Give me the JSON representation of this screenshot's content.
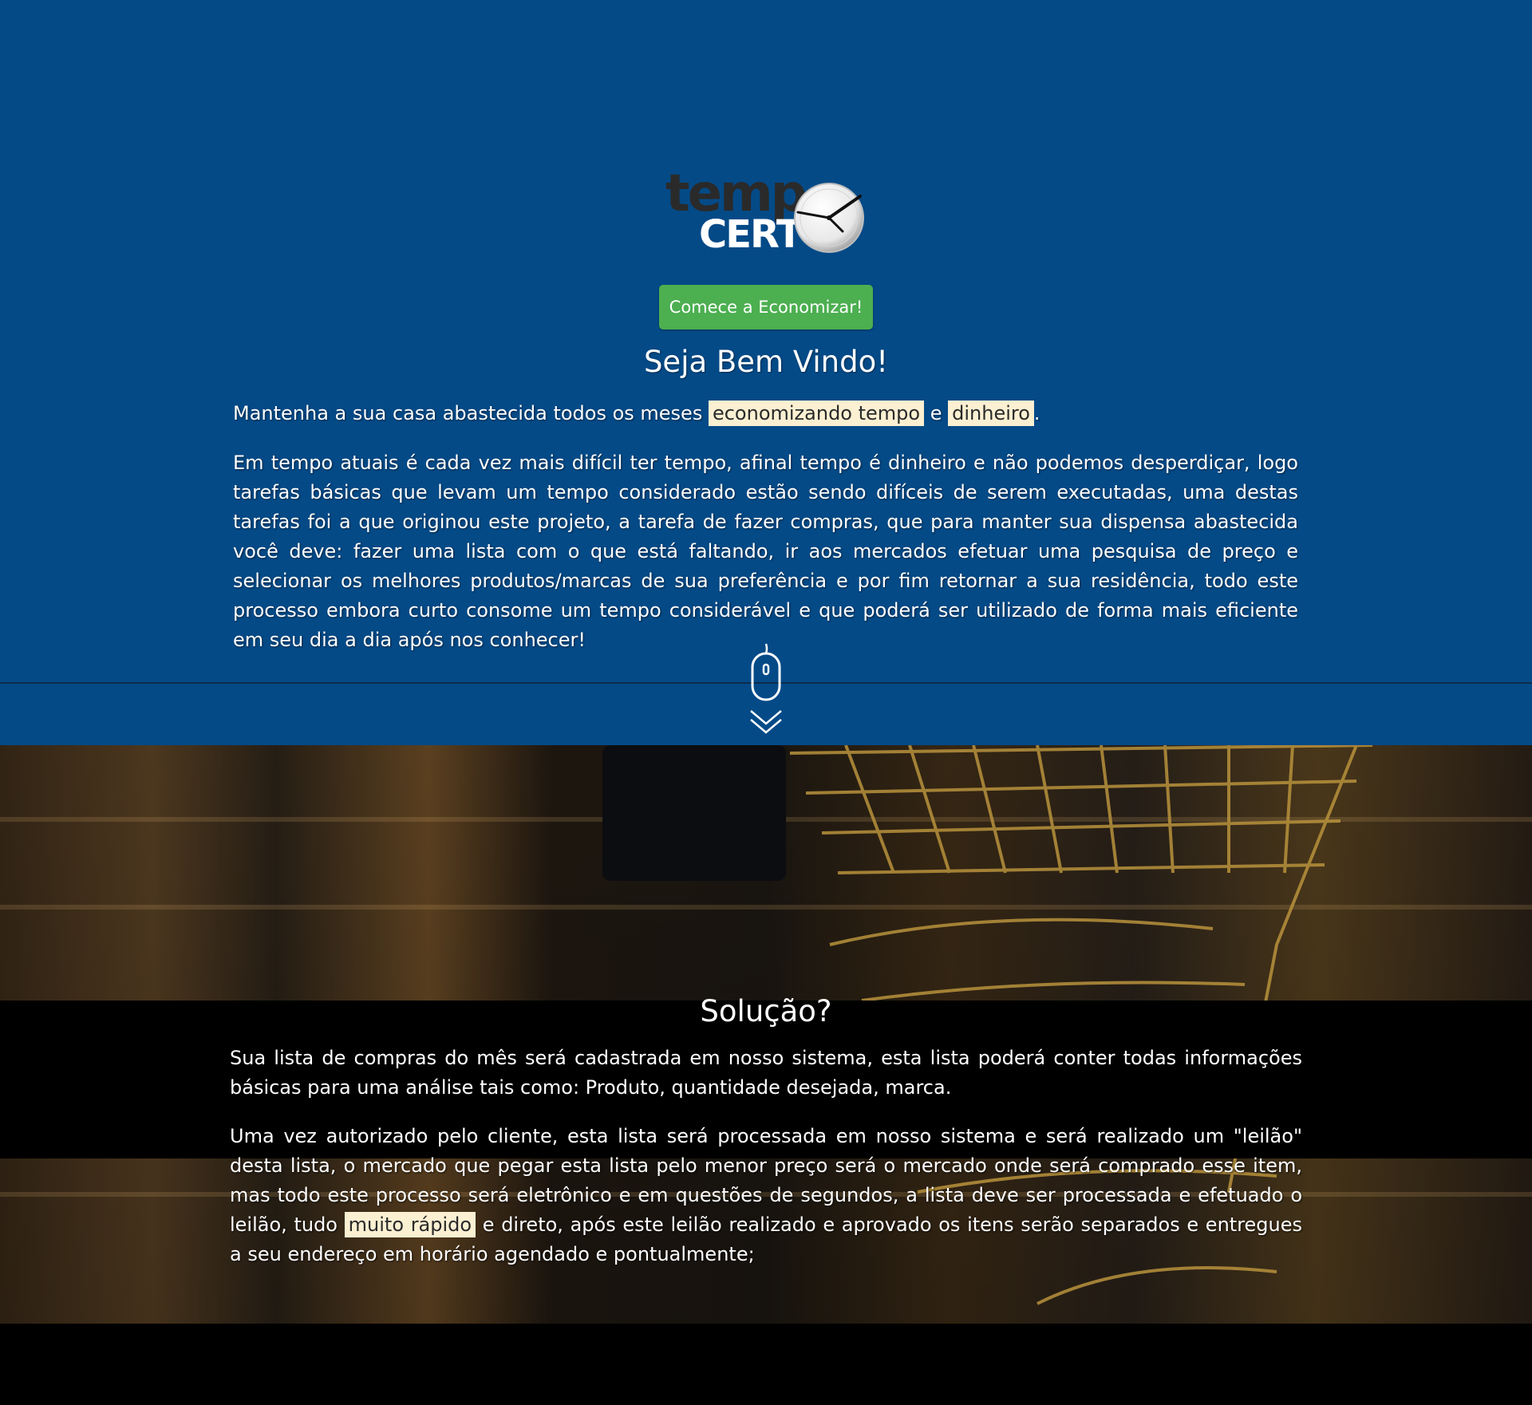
{
  "brand": {
    "logo_top": "temp",
    "logo_bottom": "CERT"
  },
  "hero": {
    "cta_label": "Comece a Economizar!",
    "title": "Seja Bem Vindo!",
    "intro_before": "Mantenha a sua casa abastecida todos os meses ",
    "intro_highlight_1": "economizando tempo",
    "intro_middle": " e ",
    "intro_highlight_2": "dinheiro",
    "intro_after": ".",
    "paragraph": "Em tempo atuais é cada vez mais difícil ter tempo, afinal tempo é dinheiro e não podemos desperdiçar, logo tarefas básicas que levam um tempo considerado estão sendo difíceis de serem executadas, uma destas tarefas foi a que originou este projeto, a tarefa de fazer compras, que para manter sua dispensa abastecida você deve: fazer uma lista com o que está faltando, ir aos mercados efetuar uma pesquisa de preço e selecionar os melhores produtos/marcas de sua preferência e por fim retornar a sua residência, todo este processo embora curto consome um tempo considerável e que poderá ser utilizado de forma mais eficiente em seu dia a dia após nos conhecer!"
  },
  "solution": {
    "title": "Solução?",
    "paragraph_1": "Sua lista de compras do mês será cadastrada em nosso sistema, esta lista poderá conter todas informações básicas para uma análise tais como: Produto, quantidade desejada, marca.",
    "paragraph_2_before": "Uma vez autorizado pelo cliente, esta lista será processada em nosso sistema e será realizado um \"leilão\" desta lista, o mercado que pegar esta lista pelo menor preço será o mercado onde será comprado esse item, mas todo este processo será eletrônico e em questões de segundos, a lista deve ser processada e efetuado o leilão, tudo ",
    "paragraph_2_highlight": "muito rápido",
    "paragraph_2_after": " e direto, após este leilão realizado e aprovado os itens serão separados e entregues a seu endereço em horário agendado e pontualmente;"
  },
  "icons": {
    "clock": "clock-icon",
    "mouse": "mouse-icon",
    "scroll_down": "chevron-double-down-icon"
  },
  "colors": {
    "hero_background": "#044a87",
    "cta_background": "#4caf50",
    "highlight_background": "#fbf0d2",
    "band_background": "#000000"
  }
}
